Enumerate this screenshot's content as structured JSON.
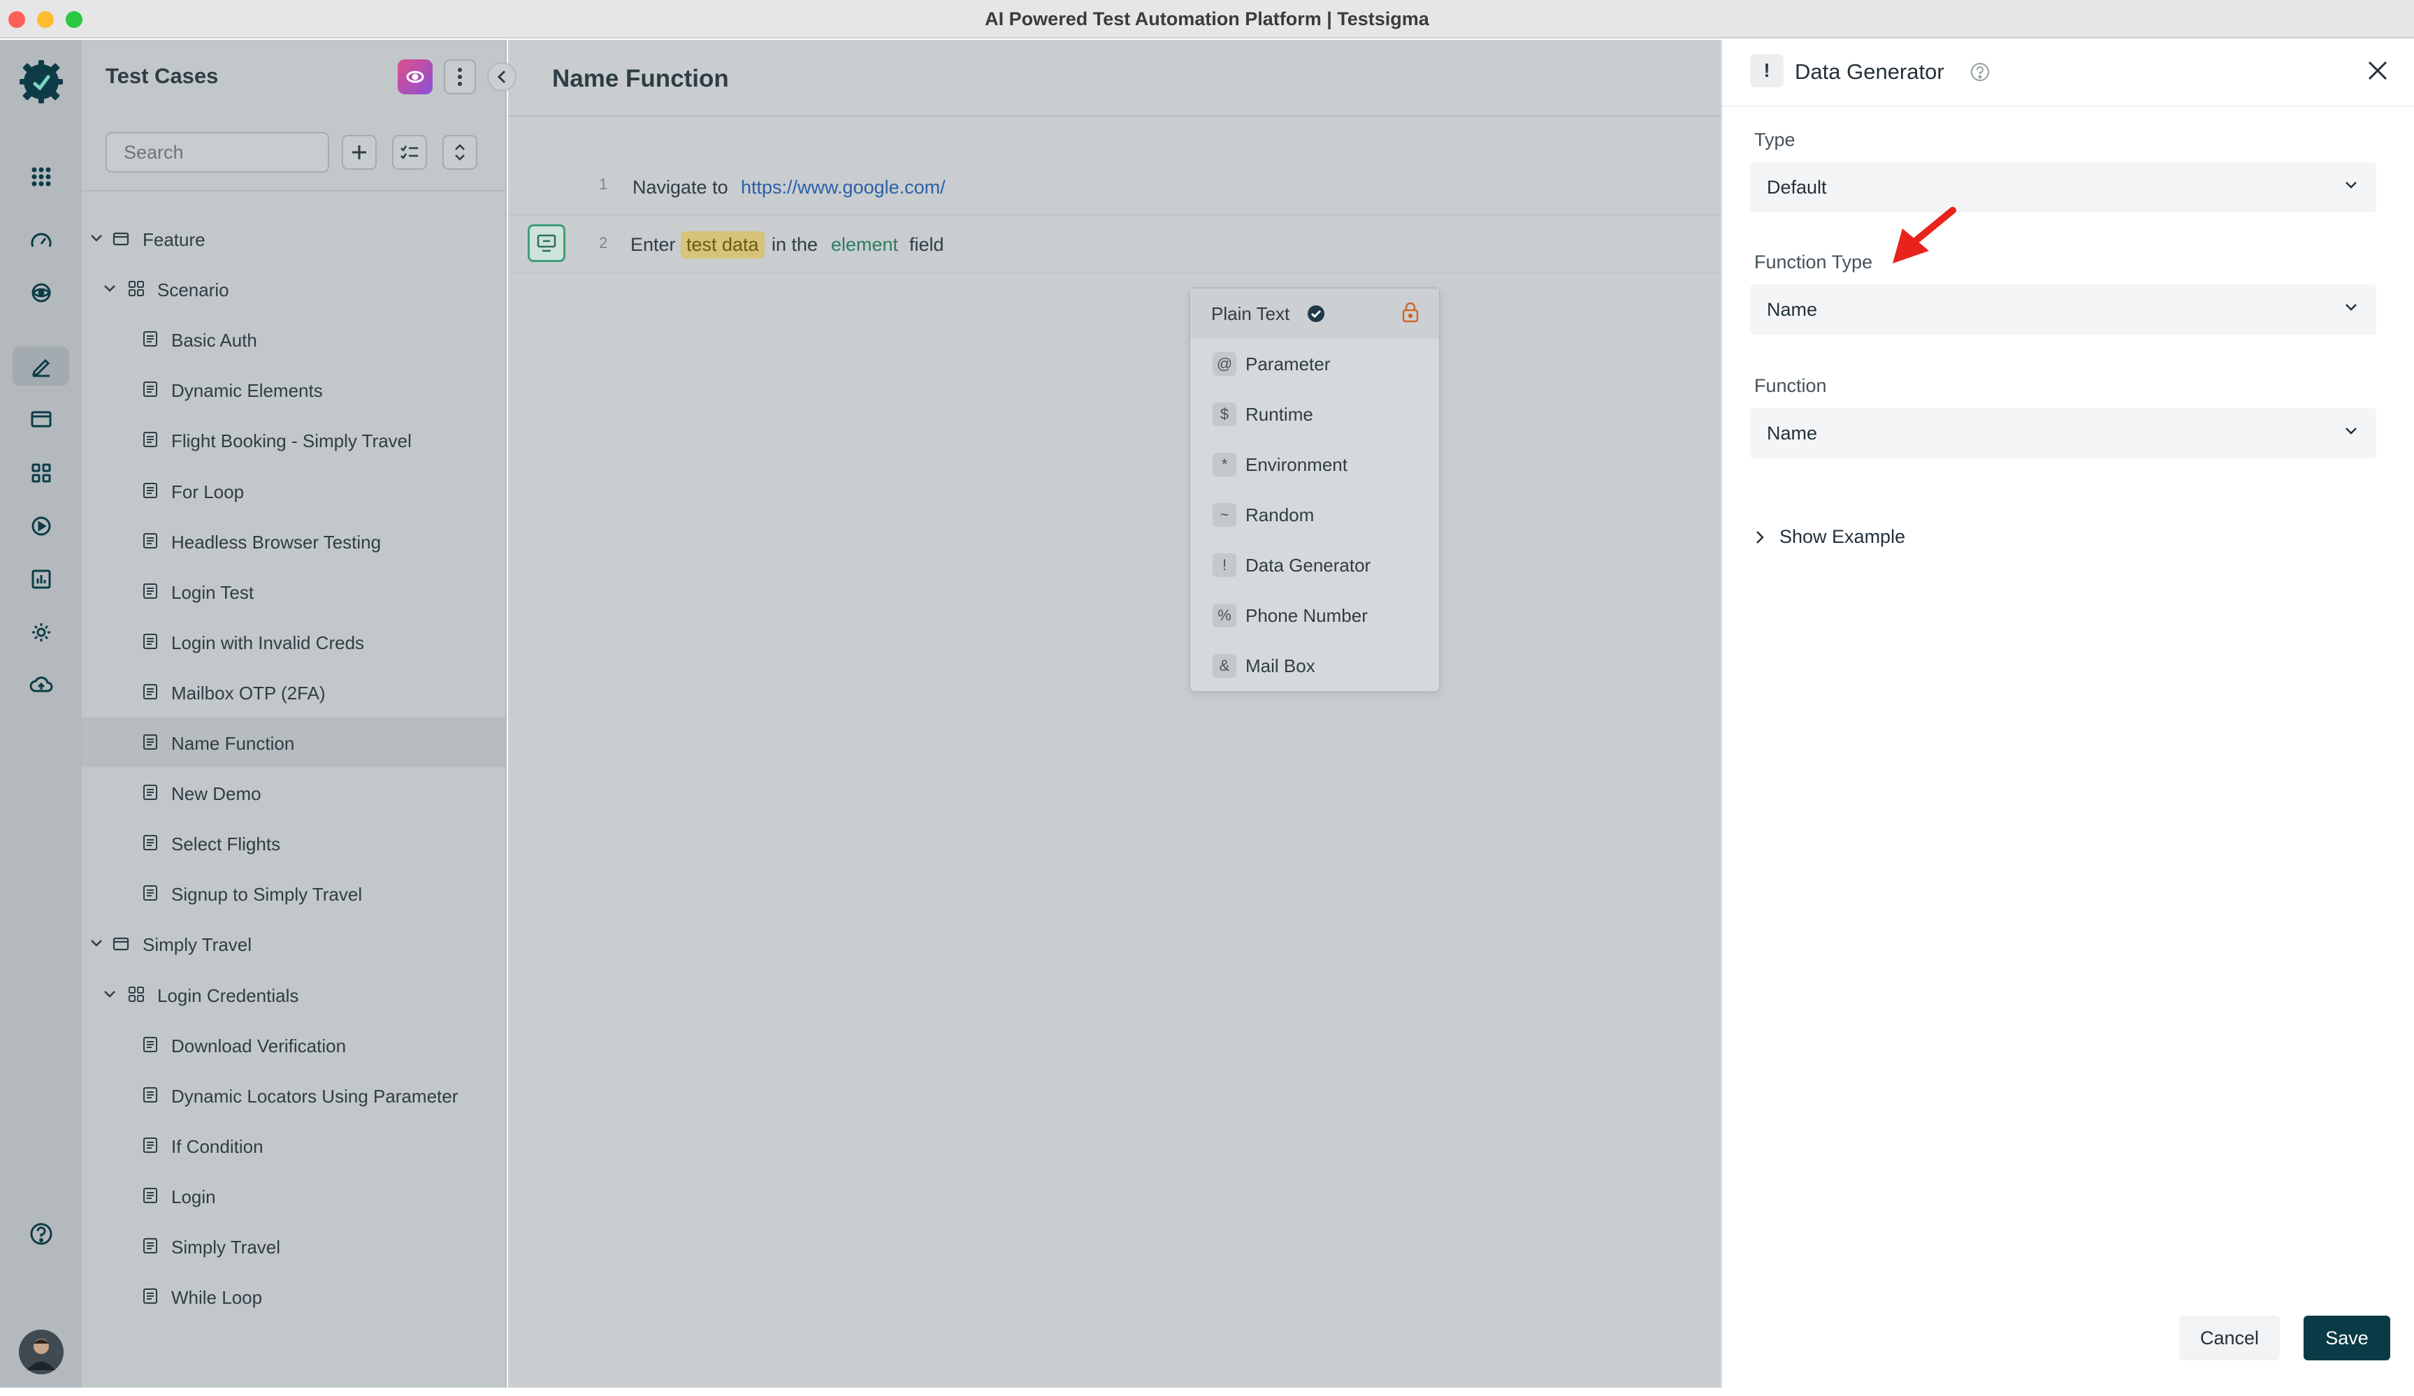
{
  "window": {
    "title": "AI Powered Test Automation Platform | Testsigma"
  },
  "sidebar": {
    "title": "Test Cases",
    "search_placeholder": "Search",
    "tree": [
      {
        "label": "Feature",
        "type": "folder",
        "level": 0
      },
      {
        "label": "Scenario",
        "type": "group",
        "level": 1
      },
      {
        "label": "Basic Auth",
        "type": "case",
        "level": 2
      },
      {
        "label": "Dynamic Elements",
        "type": "case",
        "level": 2
      },
      {
        "label": "Flight Booking - Simply Travel",
        "type": "case",
        "level": 2
      },
      {
        "label": "For Loop",
        "type": "case",
        "level": 2
      },
      {
        "label": "Headless Browser Testing",
        "type": "case",
        "level": 2
      },
      {
        "label": "Login Test",
        "type": "case",
        "level": 2
      },
      {
        "label": "Login with Invalid Creds",
        "type": "case",
        "level": 2
      },
      {
        "label": "Mailbox OTP (2FA)",
        "type": "case",
        "level": 2
      },
      {
        "label": "Name Function",
        "type": "case",
        "level": 2,
        "selected": true
      },
      {
        "label": "New Demo",
        "type": "case",
        "level": 2
      },
      {
        "label": "Select Flights",
        "type": "case",
        "level": 2
      },
      {
        "label": "Signup to Simply Travel",
        "type": "case",
        "level": 2
      },
      {
        "label": "Simply Travel",
        "type": "folder",
        "level": 0
      },
      {
        "label": "Login Credentials",
        "type": "group",
        "level": 1
      },
      {
        "label": "Download Verification",
        "type": "case",
        "level": 2
      },
      {
        "label": "Dynamic Locators Using Parameter",
        "type": "case",
        "level": 2
      },
      {
        "label": "If Condition",
        "type": "case",
        "level": 2
      },
      {
        "label": "Login",
        "type": "case",
        "level": 2
      },
      {
        "label": "Simply Travel",
        "type": "case",
        "level": 2
      },
      {
        "label": "While Loop",
        "type": "case",
        "level": 2
      }
    ]
  },
  "main": {
    "title": "Name Function",
    "steps": [
      {
        "num": "1",
        "action": "Navigate to",
        "url": "https://www.google.com/"
      },
      {
        "num": "2",
        "w1": "Enter",
        "test_data": "test data",
        "w2": "in the",
        "element": "element",
        "w3": "field"
      }
    ],
    "menu": [
      {
        "key": "",
        "label": "Plain Text",
        "selected": true
      },
      {
        "key": "@",
        "label": "Parameter"
      },
      {
        "key": "$",
        "label": "Runtime"
      },
      {
        "key": "*",
        "label": "Environment"
      },
      {
        "key": "~",
        "label": "Random"
      },
      {
        "key": "!",
        "label": "Data Generator"
      },
      {
        "key": "%",
        "label": "Phone Number"
      },
      {
        "key": "&",
        "label": "Mail Box"
      }
    ]
  },
  "panel": {
    "badge": "!",
    "title": "Data Generator",
    "type_label": "Type",
    "type_value": "Default",
    "function_type_label": "Function Type",
    "function_type_value": "Name",
    "function_label": "Function",
    "function_value": "Name",
    "show_example": "Show Example",
    "cancel": "Cancel",
    "save": "Save"
  },
  "colors": {
    "accent": "#083b45",
    "pill": "#d5c47a",
    "annotation_arrow": "#e8231c"
  },
  "rail_icons": [
    "apps-icon",
    "dashboard-icon",
    "eye-icon",
    "edit-icon",
    "folder-icon",
    "grid-icon",
    "play-icon",
    "reports-icon",
    "settings-icon",
    "cloud-icon",
    "help-icon"
  ]
}
